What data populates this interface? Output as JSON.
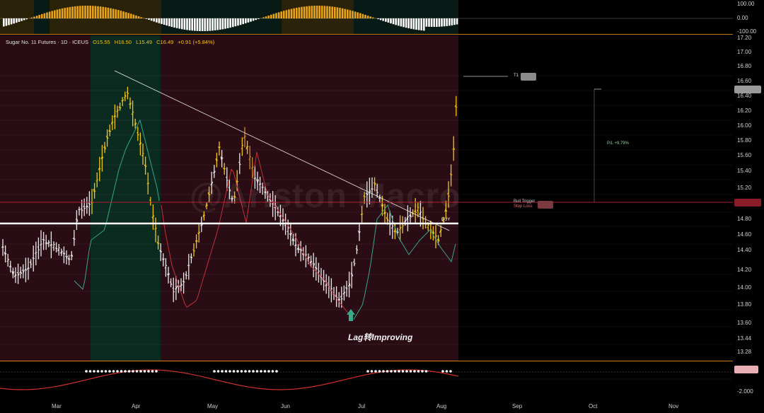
{
  "symbol_header": {
    "name": "Sugar No. 11 Futures · 1D · ICEUS",
    "open": "O15.55",
    "high": "H16.50",
    "low": "L15.49",
    "close": "C16.49",
    "change": "+0.91 (+5.84%)"
  },
  "watermark": "@Ariston Macro",
  "annotation": "Lag转Improving",
  "labels": {
    "t1": "T1",
    "buy": "BUY",
    "bull_trigger": "Bull Trigger",
    "stop_loss": "Stop Loss",
    "pnl": "P/L +9.79%"
  },
  "top_scale": [
    "100.00",
    "0.00",
    "-100.00"
  ],
  "price_scale": [
    "17.20",
    "17.00",
    "16.80",
    "16.60",
    "16.40",
    "16.20",
    "16.00",
    "15.80",
    "15.60",
    "15.40",
    "15.20",
    "14.80",
    "14.60",
    "14.40",
    "14.20",
    "14.00",
    "13.80",
    "13.60",
    "13.44",
    "13.28"
  ],
  "bottom_scale": [
    "-2.000"
  ],
  "months": [
    "Mar",
    "Apr",
    "May",
    "Jun",
    "Jul",
    "Aug",
    "Sep",
    "Oct",
    "Nov"
  ],
  "colors": {
    "bear_bg": "#2a0d14",
    "bull_bg": "#0b2a20",
    "candle_yellow": "#f0c419",
    "candle_white": "#e8e8e8",
    "candle_orange": "#d08a2a",
    "support_line": "#ffffff",
    "trigger_line": "#b02030",
    "osc_red": "#d0312d"
  }
}
